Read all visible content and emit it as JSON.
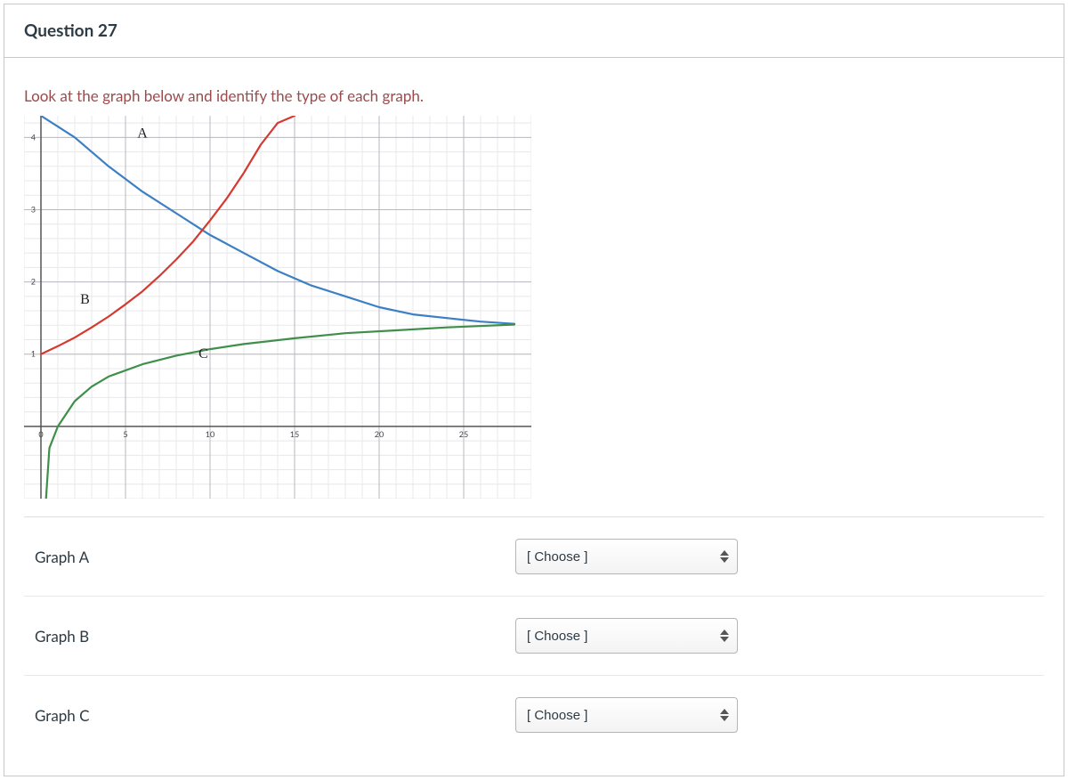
{
  "question": {
    "title": "Question 27",
    "prompt": "Look at the graph below and identify the type of each graph."
  },
  "chart_data": {
    "type": "line",
    "xlabel": "",
    "ylabel": "",
    "xlim": [
      -1,
      29
    ],
    "ylim": [
      -1,
      4.3
    ],
    "xticks": [
      0,
      5,
      10,
      15,
      20,
      25
    ],
    "yticks": [
      1,
      2,
      3,
      4
    ],
    "series": [
      {
        "name": "A",
        "label_pos": {
          "x": 6,
          "y": 4.0
        },
        "color": "#3b7fc4",
        "x": [
          0,
          2,
          4,
          6,
          8,
          10,
          12,
          14,
          16,
          18,
          20,
          22,
          24,
          26,
          28
        ],
        "y": [
          4.3,
          4.0,
          3.6,
          3.25,
          2.95,
          2.65,
          2.4,
          2.15,
          1.95,
          1.8,
          1.65,
          1.55,
          1.5,
          1.45,
          1.42
        ]
      },
      {
        "name": "B",
        "label_pos": {
          "x": 2.6,
          "y": 1.7
        },
        "color": "#d43a2f",
        "x": [
          0,
          1,
          2,
          3,
          4,
          5,
          6,
          7,
          8,
          9,
          10,
          11,
          12,
          13,
          14,
          15
        ],
        "y": [
          1.0,
          1.11,
          1.23,
          1.37,
          1.52,
          1.69,
          1.87,
          2.08,
          2.31,
          2.56,
          2.85,
          3.16,
          3.51,
          3.9,
          4.2,
          4.3
        ]
      },
      {
        "name": "C",
        "label_pos": {
          "x": 9.6,
          "y": 0.95
        },
        "color": "#3f8f4a",
        "x": [
          0.3,
          0.5,
          1,
          2,
          3,
          4,
          6,
          8,
          10,
          12,
          15,
          18,
          21,
          24,
          28
        ],
        "y": [
          -1.0,
          -0.3,
          0.0,
          0.35,
          0.55,
          0.69,
          0.86,
          0.98,
          1.07,
          1.14,
          1.22,
          1.29,
          1.33,
          1.37,
          1.41
        ]
      }
    ]
  },
  "matches": [
    {
      "label": "Graph A",
      "placeholder": "[ Choose ]"
    },
    {
      "label": "Graph B",
      "placeholder": "[ Choose ]"
    },
    {
      "label": "Graph C",
      "placeholder": "[ Choose ]"
    }
  ]
}
